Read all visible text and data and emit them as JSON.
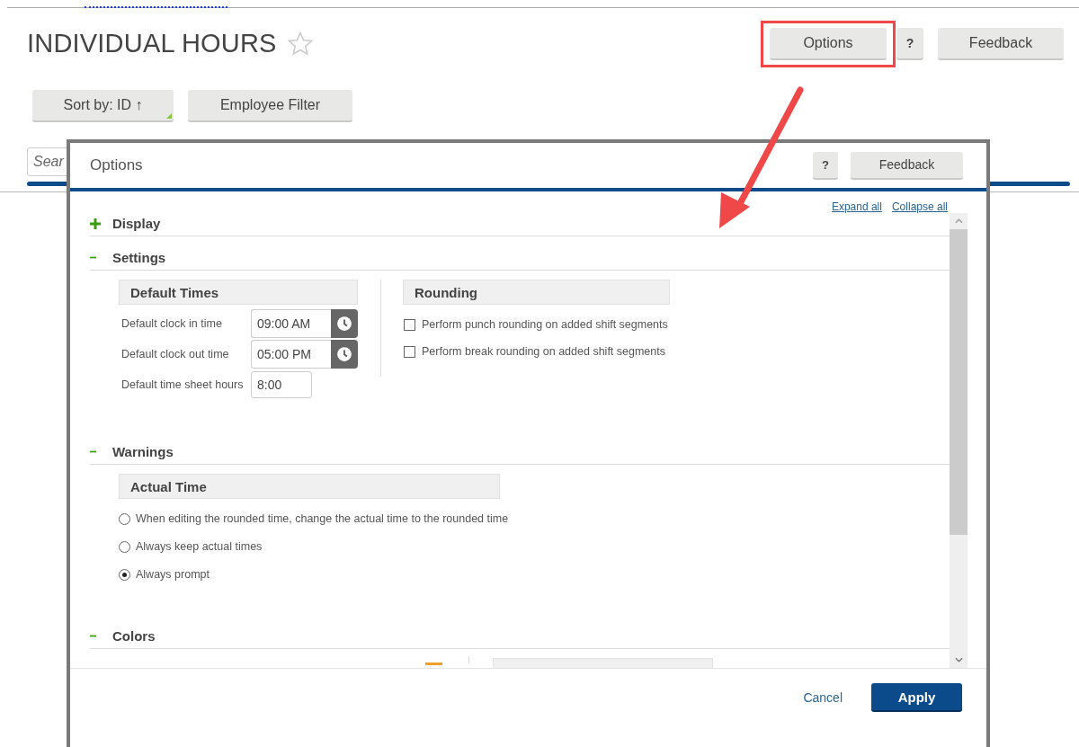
{
  "page": {
    "title": "INDIVIDUAL HOURS",
    "favorite": false,
    "header_buttons": [
      {
        "label": "Options",
        "highlighted": true
      },
      {
        "label": "?",
        "highlighted": false
      },
      {
        "label": "Feedback",
        "highlighted": false
      }
    ],
    "toolbar_buttons": [
      {
        "label": "Sort by: ID ↑",
        "corner_mark": true
      },
      {
        "label": "Employee Filter",
        "corner_mark": false
      }
    ],
    "search": {
      "placeholder": "Sear"
    }
  },
  "dialog": {
    "title": "Options",
    "header_buttons": [
      "?",
      "Feedback"
    ],
    "links": [
      "Expand all",
      "Collapse all"
    ],
    "sections": [
      {
        "title": "Display",
        "expanded": false
      },
      {
        "title": "Settings",
        "expanded": true,
        "groups": [
          {
            "kind": "fields",
            "title": "Default Times",
            "fields": [
              {
                "kind": "time",
                "label": "Default clock in time",
                "value": "09:00 AM"
              },
              {
                "kind": "time",
                "label": "Default clock out time",
                "value": "05:00 PM"
              },
              {
                "kind": "text",
                "label": "Default time sheet hours",
                "value": "8:00"
              }
            ]
          },
          {
            "kind": "checkboxes",
            "title": "Rounding",
            "options": [
              {
                "label": "Perform punch rounding on added shift segments",
                "checked": false
              },
              {
                "label": "Perform break rounding on added shift segments",
                "checked": false
              }
            ]
          }
        ]
      },
      {
        "title": "Warnings",
        "expanded": true,
        "groups": [
          {
            "kind": "radios",
            "title": "Actual Time",
            "options": [
              {
                "label": "When editing the rounded time, change the actual time to the rounded time",
                "selected": false
              },
              {
                "label": "Always keep actual times",
                "selected": false
              },
              {
                "label": "Always prompt",
                "selected": true
              }
            ]
          }
        ]
      },
      {
        "title": "Colors",
        "expanded": true,
        "groups": [
          {
            "kind": "swatch",
            "color": "#f0a030"
          },
          {
            "kind": "panel"
          }
        ]
      }
    ],
    "footer": {
      "cancel": "Cancel",
      "apply": "Apply"
    }
  }
}
